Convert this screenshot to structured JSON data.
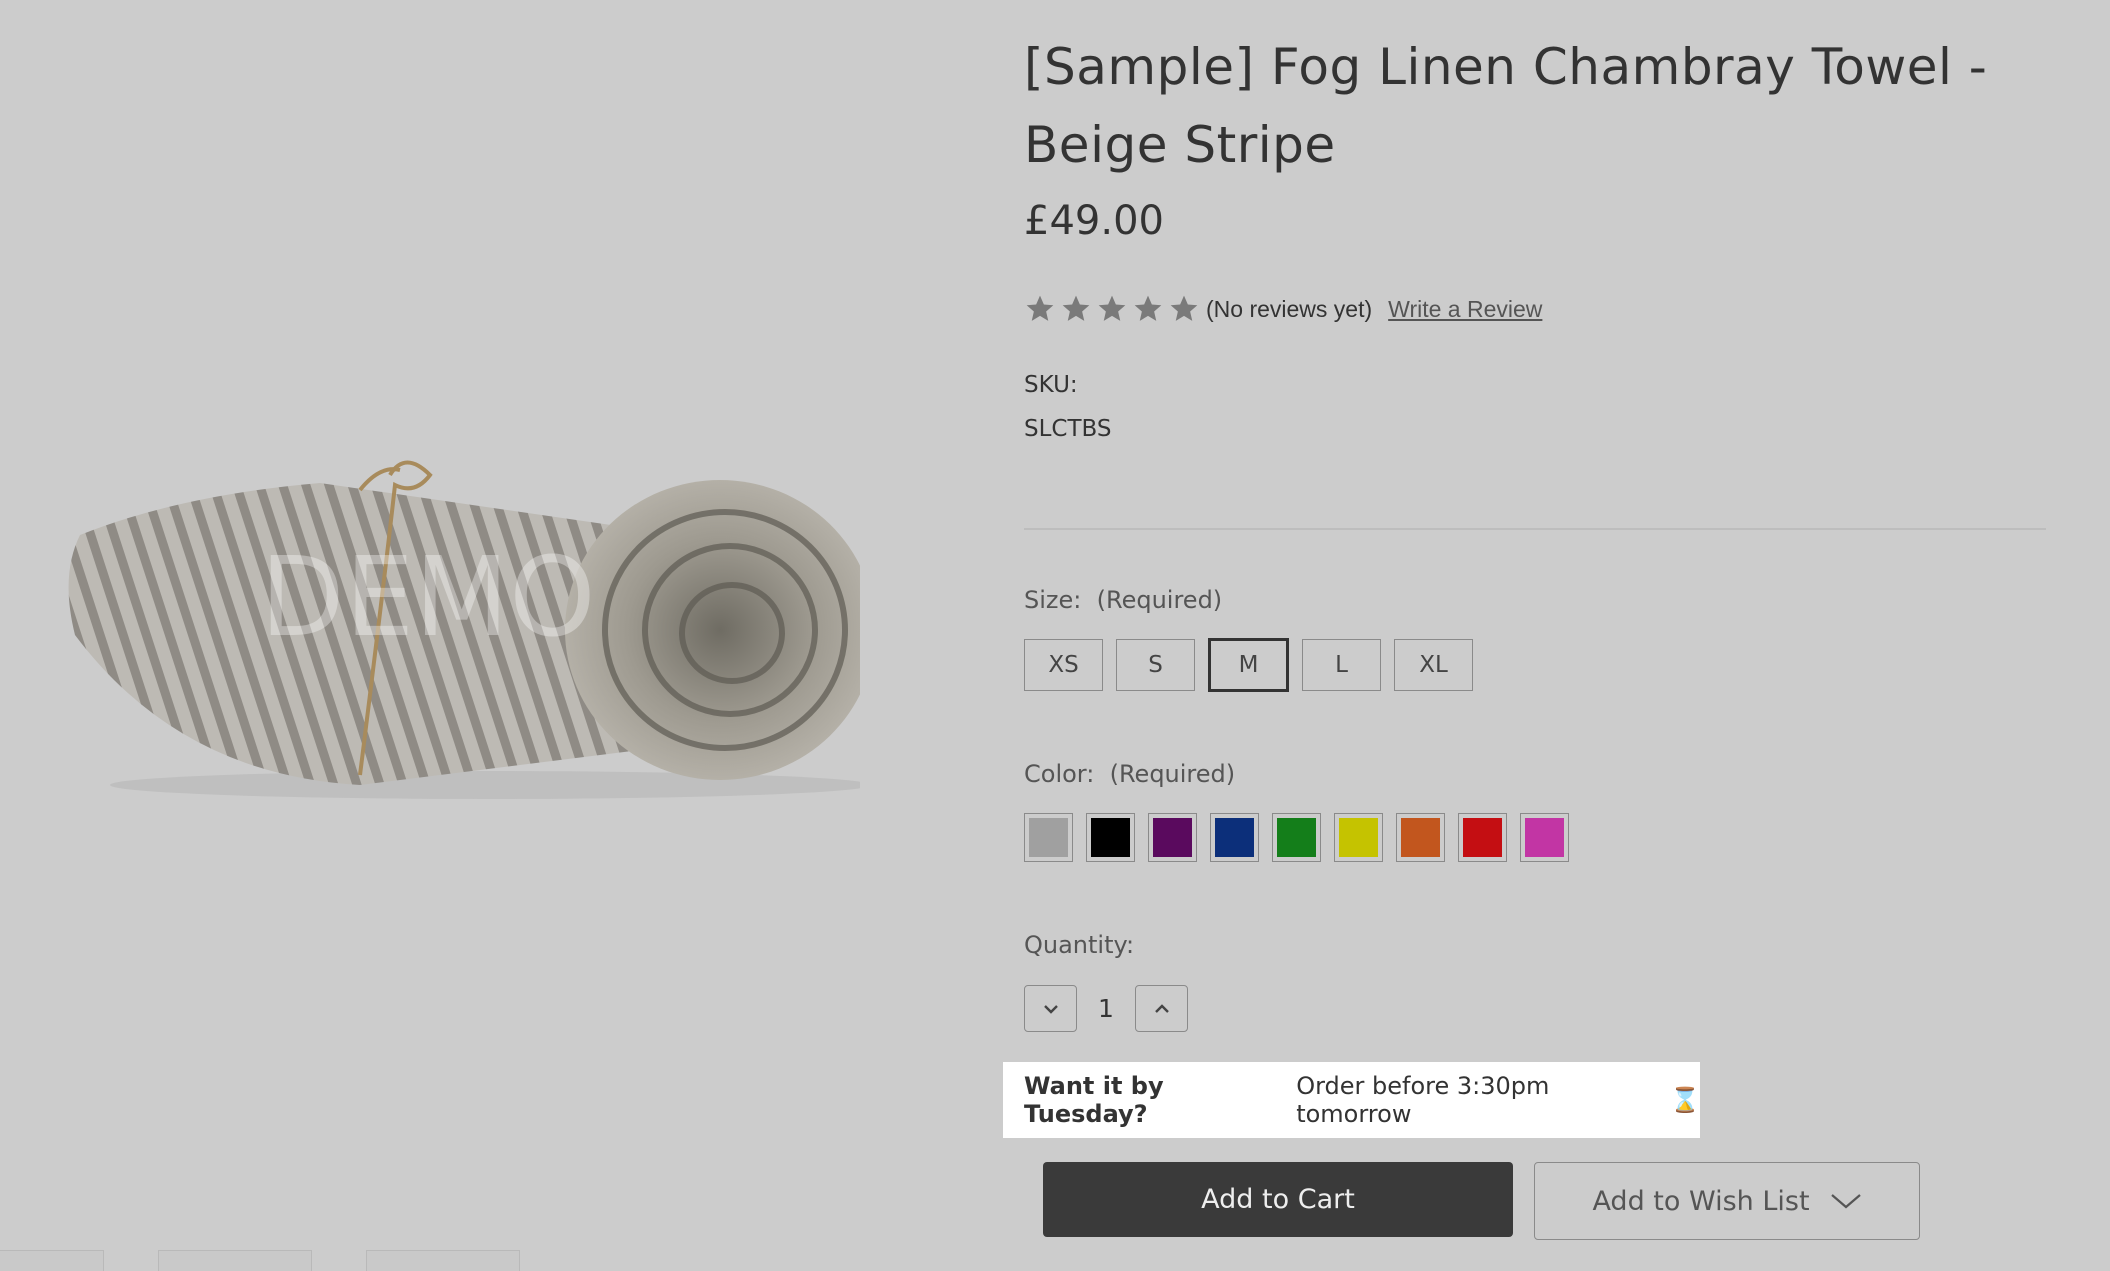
{
  "product": {
    "title": "[Sample] Fog Linen Chambray Towel - Beige Stripe",
    "price": "£49.00",
    "image_watermark": "DEMO",
    "rating": {
      "stars_filled": 0,
      "stars_total": 5,
      "reviews_text": "(No reviews yet)",
      "write_review_label": "Write a Review"
    },
    "sku_label": "SKU:",
    "sku_value": "SLCTBS"
  },
  "options": {
    "size": {
      "label": "Size:",
      "required": "(Required)",
      "values": [
        "XS",
        "S",
        "M",
        "L",
        "XL"
      ],
      "selected": "M"
    },
    "color": {
      "label": "Color:",
      "required": "(Required)",
      "swatches": [
        "#a0a0a0",
        "#000000",
        "#5a0a5e",
        "#0c2f7a",
        "#147e1a",
        "#c5c300",
        "#c2561e",
        "#c40e12",
        "#c235a4"
      ]
    }
  },
  "quantity": {
    "label": "Quantity:",
    "value": "1"
  },
  "delivery": {
    "bold": "Want it by Tuesday?",
    "text": "Order before 3:30pm tomorrow",
    "icon": "⌛"
  },
  "actions": {
    "add_to_cart": "Add to Cart",
    "add_to_wishlist": "Add to Wish List"
  },
  "icons": {
    "star": "star-icon",
    "decrease": "chevron-down-icon",
    "increase": "chevron-up-icon",
    "wishlist_toggle": "chevron-down-icon"
  }
}
